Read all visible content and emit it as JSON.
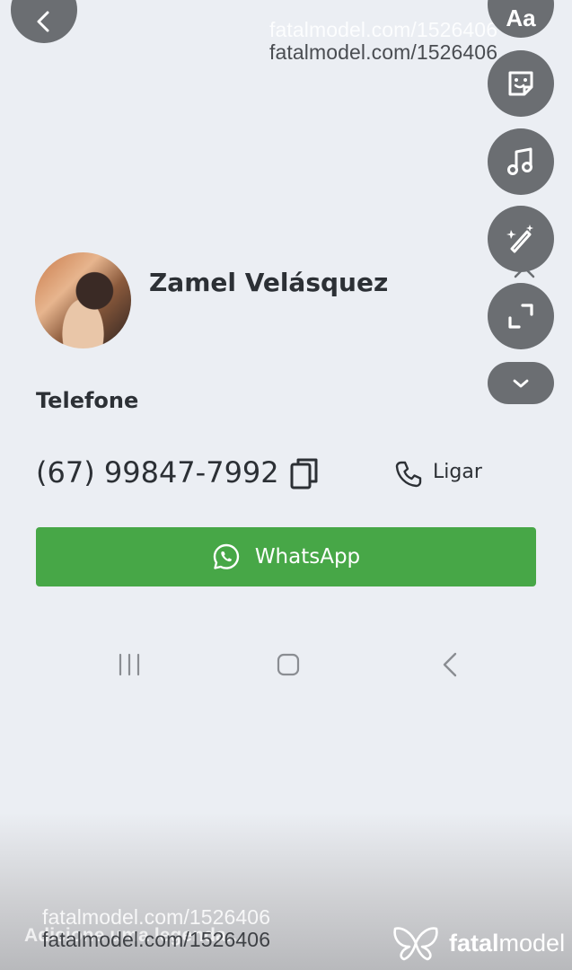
{
  "watermark": {
    "top_ghost": "fatalmodel.com/1526406",
    "top": "fatalmodel.com/1526406",
    "bottom_ghost": "fatalmodel.com/1526406",
    "bottom": "fatalmodel.com/1526406",
    "caption_behind": "Adicione uma legenda..."
  },
  "editor": {
    "text_tool_label": "Aa",
    "tools": [
      "sticker-icon",
      "music-icon",
      "draw-icon",
      "expand-icon",
      "chevron-down-icon"
    ]
  },
  "profile": {
    "name": "Zamel Velásquez"
  },
  "contact": {
    "section_label": "Telefone",
    "phone": "(67) 99847-7992",
    "call_label": "Ligar",
    "whatsapp_label": "WhatsApp"
  },
  "brand": {
    "name_bold": "fatal",
    "name_regular": "model"
  },
  "colors": {
    "background": "#ebeef3",
    "whatsapp_green": "#47a747",
    "tool_button": "#6b6e72"
  }
}
